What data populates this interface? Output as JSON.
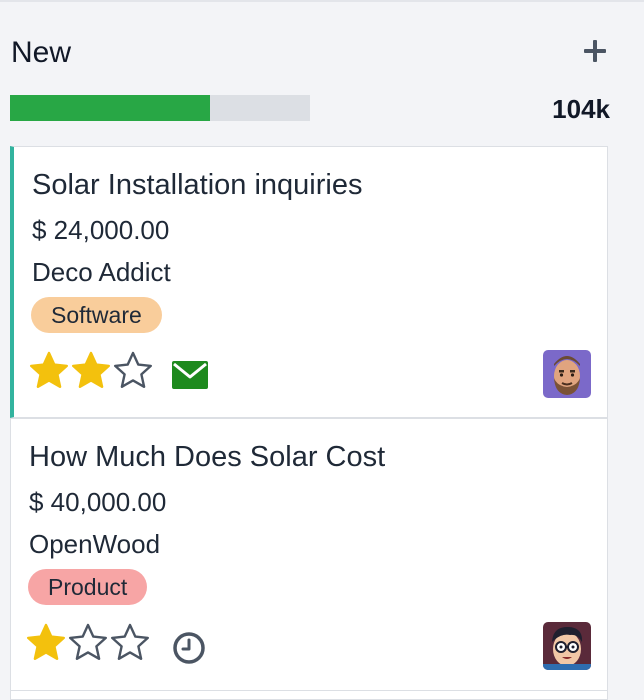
{
  "column": {
    "title": "New",
    "total": "104k",
    "progress_fraction": 0.667
  },
  "cards": [
    {
      "title": "Solar Installation inquiries",
      "amount": "$ 24,000.00",
      "customer": "Deco Addict",
      "tag": {
        "label": "Software",
        "color": "#f9cd9b"
      },
      "stars_filled": 2,
      "stars_total": 3,
      "activity_icon": "envelope-icon",
      "activity_color": "#1e8a1e",
      "avatar": "avatar-bearded-man"
    },
    {
      "title": "How Much Does Solar Cost",
      "amount": "$ 40,000.00",
      "customer": "OpenWood",
      "tag": {
        "label": "Product",
        "color": "#f7a5a5"
      },
      "stars_filled": 1,
      "stars_total": 3,
      "activity_icon": "clock-icon",
      "activity_color": "#4b5563",
      "avatar": "avatar-glasses-man"
    }
  ],
  "colors": {
    "star_filled": "#f3c10d",
    "star_empty": "#4b5563",
    "progress_fill": "#28a745",
    "card_accent": "#32b39e"
  }
}
